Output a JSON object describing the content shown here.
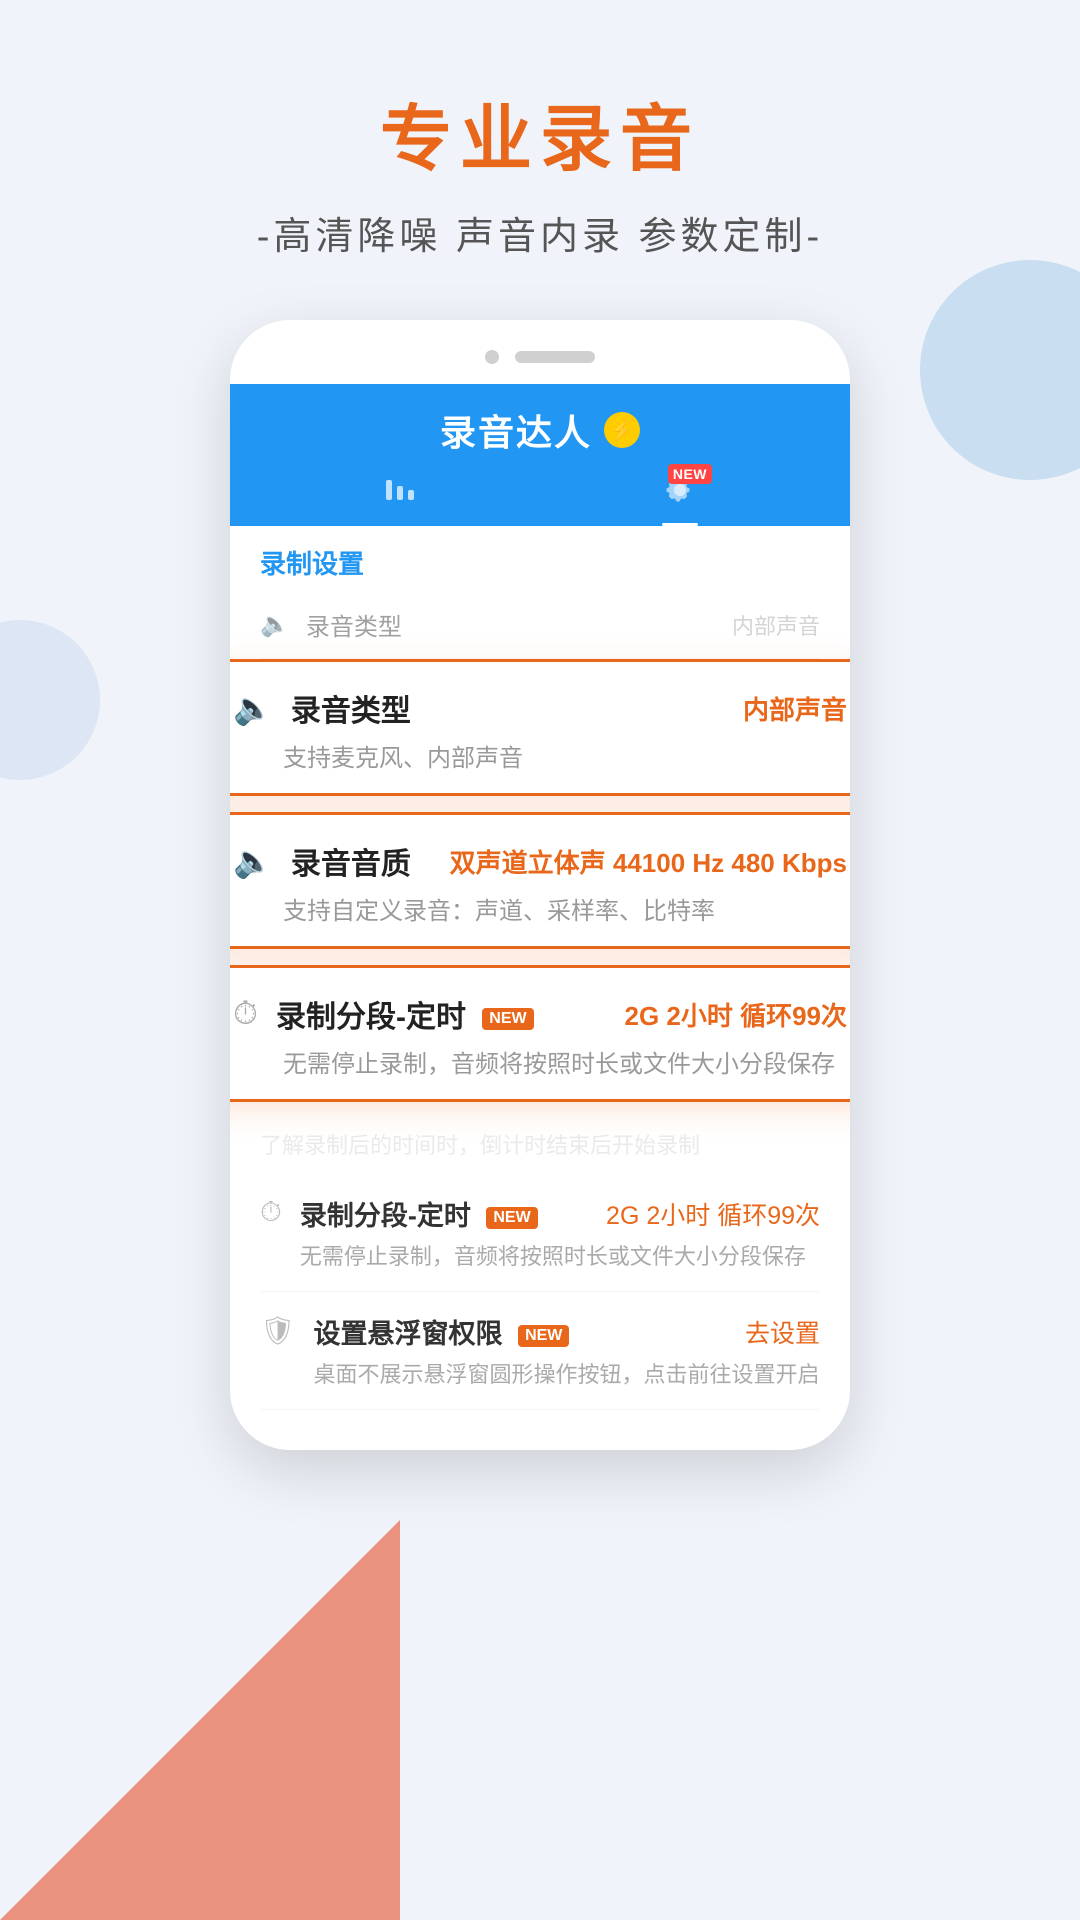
{
  "page": {
    "background_color": "#f0f4fa"
  },
  "hero": {
    "title": "专业录音",
    "subtitle": "-高清降噪 声音内录 参数定制-"
  },
  "app": {
    "name": "录音达人",
    "badge_symbol": "⚡",
    "nav_tabs": [
      {
        "icon": "bars",
        "label": "录音列表",
        "active": false
      },
      {
        "icon": "gear",
        "label": "设置",
        "active": true,
        "new": true
      }
    ],
    "header_new_badge": "NEW"
  },
  "settings": {
    "section_title": "录制设置",
    "rows_small": [
      {
        "icon": "🔈",
        "label": "录音类型",
        "value": "内部声音"
      }
    ],
    "highlight_cards": [
      {
        "id": "record_type",
        "icon": "🔈",
        "label": "录音类型",
        "value": "内部声音",
        "desc": "支持麦克风、内部声音"
      },
      {
        "id": "record_quality",
        "icon": "🔈",
        "label": "录音音质",
        "value": "双声道立体声 44100 Hz 480 Kbps",
        "desc": "支持自定义录音：声道、采样率、比特率"
      },
      {
        "id": "record_segment",
        "icon": "⏱",
        "label": "录制分段-定时",
        "new_badge": "NEW",
        "value": "2G 2小时 循环99次",
        "desc": "无需停止录制，音频将按照时长或文件大小分段保存"
      }
    ],
    "rows_phone_lower": [
      {
        "id": "faded_segment",
        "icon": "⏱",
        "label": "录制分段-定时",
        "new_badge": "NEW",
        "value": "2G 2小时 循环99次",
        "desc": "无需停止录制，音频将按照时长或文件大小分段保存",
        "faded": true
      },
      {
        "id": "float_permission",
        "icon": "🛡",
        "label": "设置悬浮窗权限",
        "new_badge": "NEW",
        "value": "去设置",
        "desc": "桌面不展示悬浮窗圆形操作按钮，点击前往设置开启",
        "faded": false
      }
    ]
  }
}
